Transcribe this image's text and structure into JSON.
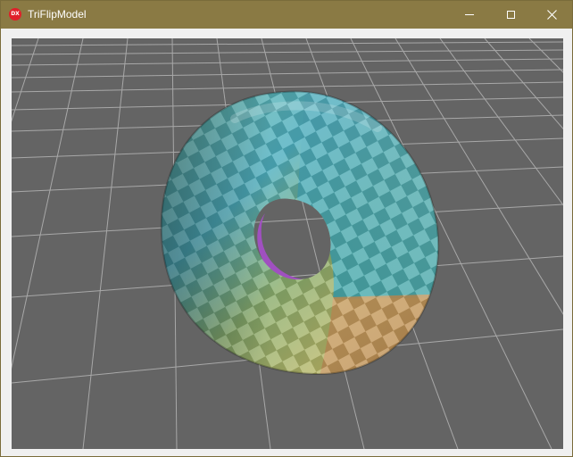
{
  "window": {
    "title": "TriFlipModel",
    "app_icon_text": "DX",
    "controls": [
      "minimize",
      "maximize",
      "close"
    ]
  },
  "colors": {
    "titlebar": "#8a7a44",
    "viewport_background": "#646464",
    "grid_lines": "#b4b4b4",
    "torus_cyan": "#4fb0c0",
    "torus_green": "#8aae6e",
    "torus_yellow": "#b8b86a",
    "torus_orange": "#c89a5a",
    "torus_magenta": "#a050c0"
  },
  "viewport": {
    "icon": "3d-scene-icon",
    "content": "checkered-torus-model"
  }
}
